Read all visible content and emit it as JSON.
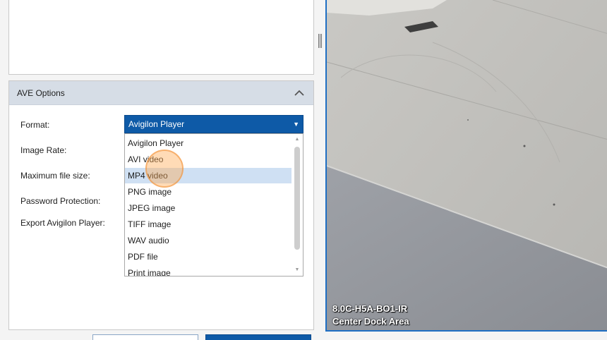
{
  "ave_options": {
    "title": "AVE Options",
    "labels": {
      "format": "Format:",
      "image_rate": "Image Rate:",
      "max_file_size": "Maximum file size:",
      "password_protection": "Password Protection:",
      "export_player": "Export Avigilon Player:"
    },
    "format_selected": "Avigilon Player",
    "format_options": [
      "Avigilon Player",
      "AVI video",
      "MP4 video",
      "PNG image",
      "JPEG image",
      "TIFF image",
      "WAV audio",
      "PDF file",
      "Print image"
    ],
    "highlighted_option": "MP4 video"
  },
  "camera": {
    "name": "8.0C-H5A-BO1-IR",
    "location": "Center Dock Area"
  },
  "colors": {
    "accent": "#0e5aa7",
    "header_bg": "#d6dde6",
    "selection": "#cfe0f3",
    "video_border": "#1f6fc4",
    "cursor_highlight": "#f5a050"
  },
  "icons": {
    "collapse": "chevron-up-icon",
    "dropdown_arrow": "caret-down-icon",
    "scroll_up": "scroll-up-icon",
    "scroll_down": "scroll-down-icon"
  }
}
